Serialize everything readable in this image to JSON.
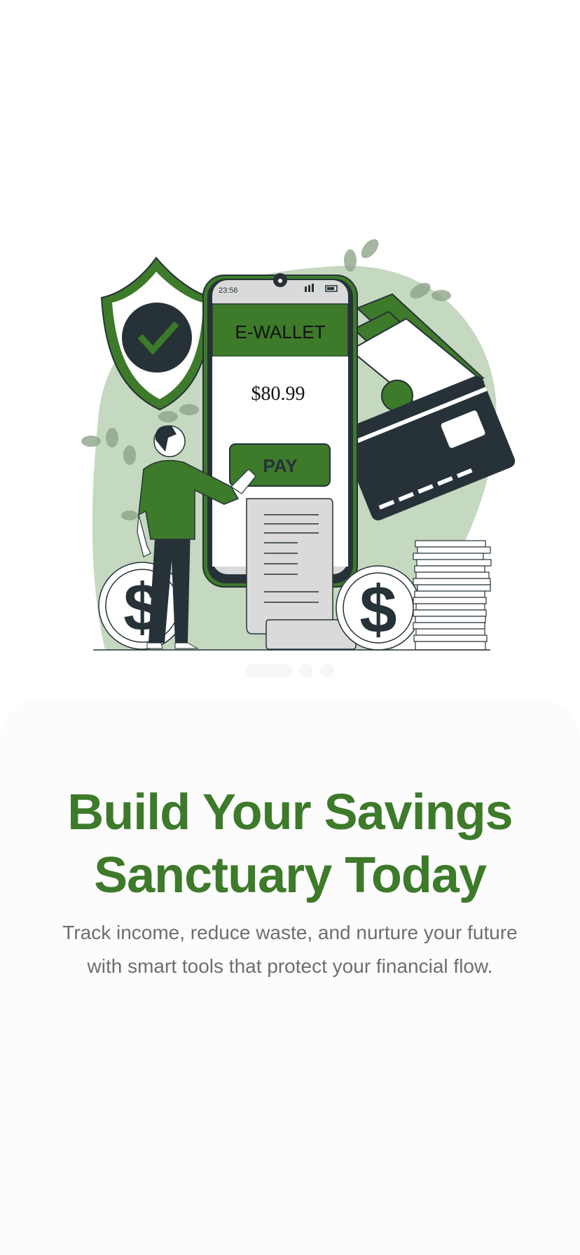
{
  "illustration": {
    "phone_time": "23:56",
    "app_title": "E-WALLET",
    "balance": "$80.99",
    "pay_label": "PAY"
  },
  "pager": {
    "count": 3,
    "active": 0
  },
  "onboarding": {
    "title_line1": "Build Your Savings",
    "title_line2": "Sanctuary Today",
    "subtitle": "Track income, reduce waste, and nurture your future with smart tools that protect your financial flow."
  },
  "colors": {
    "accent": "#3d7a2a",
    "dark": "#263238",
    "blob": "#c5d8c0"
  }
}
